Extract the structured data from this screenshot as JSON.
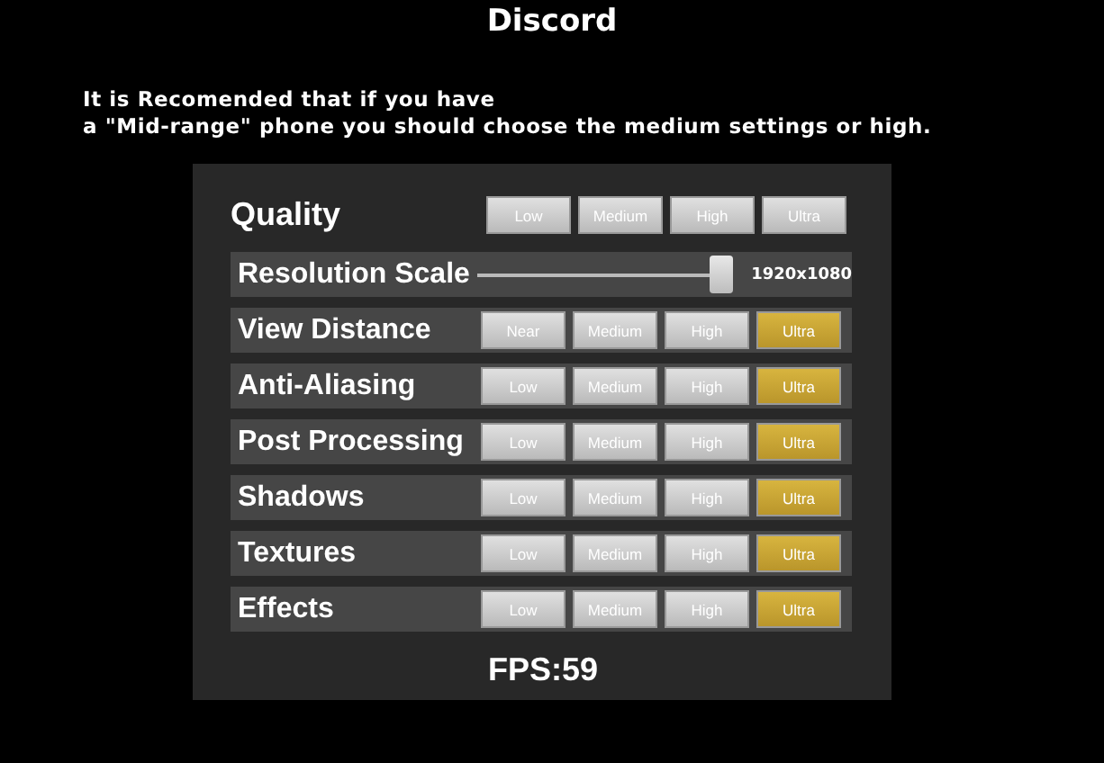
{
  "title": "Discord",
  "notice": [
    "It is Recomended that if you have",
    "a \"Mid-range\" phone you should choose the medium settings or high."
  ],
  "settings": [
    {
      "kind": "heading",
      "label": "Quality",
      "options": [
        {
          "label": "Low",
          "selected": false
        },
        {
          "label": "Medium",
          "selected": false
        },
        {
          "label": "High",
          "selected": false
        },
        {
          "label": "Ultra",
          "selected": false
        }
      ]
    },
    {
      "kind": "slider",
      "label": "Resolution Scale",
      "level": 1,
      "reading": "1920x1080"
    },
    {
      "kind": "options",
      "label": "View Distance",
      "options": [
        {
          "label": "Near",
          "selected": false
        },
        {
          "label": "Medium",
          "selected": false
        },
        {
          "label": "High",
          "selected": false
        },
        {
          "label": "Ultra",
          "selected": true
        }
      ]
    },
    {
      "kind": "options",
      "label": "Anti-Aliasing",
      "options": [
        {
          "label": "Low",
          "selected": false
        },
        {
          "label": "Medium",
          "selected": false
        },
        {
          "label": "High",
          "selected": false
        },
        {
          "label": "Ultra",
          "selected": true
        }
      ]
    },
    {
      "kind": "options",
      "label": "Post Processing",
      "options": [
        {
          "label": "Low",
          "selected": false
        },
        {
          "label": "Medium",
          "selected": false
        },
        {
          "label": "High",
          "selected": false
        },
        {
          "label": "Ultra",
          "selected": true
        }
      ]
    },
    {
      "kind": "options",
      "label": "Shadows",
      "options": [
        {
          "label": "Low",
          "selected": false
        },
        {
          "label": "Medium",
          "selected": false
        },
        {
          "label": "High",
          "selected": false
        },
        {
          "label": "Ultra",
          "selected": true
        }
      ]
    },
    {
      "kind": "options",
      "label": "Textures",
      "options": [
        {
          "label": "Low",
          "selected": false
        },
        {
          "label": "Medium",
          "selected": false
        },
        {
          "label": "High",
          "selected": false
        },
        {
          "label": "Ultra",
          "selected": true
        }
      ]
    },
    {
      "kind": "options",
      "label": "Effects",
      "options": [
        {
          "label": "Low",
          "selected": false
        },
        {
          "label": "Medium",
          "selected": false
        },
        {
          "label": "High",
          "selected": false
        },
        {
          "label": "Ultra",
          "selected": true
        }
      ]
    }
  ],
  "fps": "FPS:59"
}
